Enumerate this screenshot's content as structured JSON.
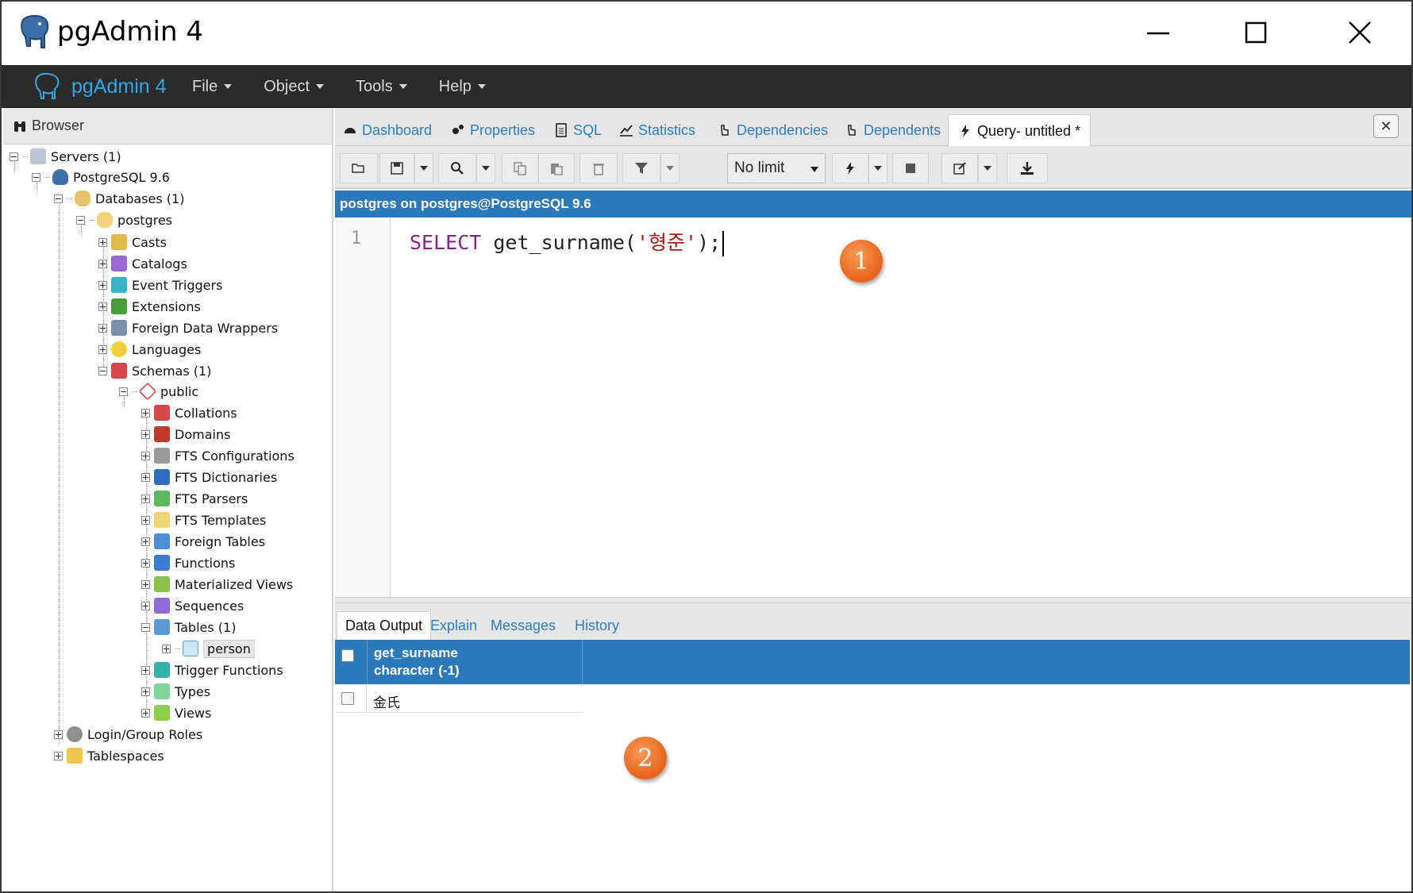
{
  "window": {
    "title": "pgAdmin 4"
  },
  "navbar": {
    "brand": "pgAdmin 4",
    "menus": [
      "File",
      "Object",
      "Tools",
      "Help"
    ]
  },
  "browser": {
    "title": "Browser",
    "tree": [
      "Servers (1)",
      "PostgreSQL 9.6",
      "Databases (1)",
      "postgres",
      "Casts",
      "Catalogs",
      "Event Triggers",
      "Extensions",
      "Foreign Data Wrappers",
      "Languages",
      "Schemas (1)",
      "public",
      "Collations",
      "Domains",
      "FTS Configurations",
      "FTS Dictionaries",
      "FTS Parsers",
      "FTS Templates",
      "Foreign Tables",
      "Functions",
      "Materialized Views",
      "Sequences",
      "Tables (1)",
      "person",
      "Trigger Functions",
      "Types",
      "Views",
      "Login/Group Roles",
      "Tablespaces"
    ]
  },
  "tabs": [
    "Dashboard",
    "Properties",
    "SQL",
    "Statistics",
    "Dependencies",
    "Dependents",
    "Query- untitled *"
  ],
  "toolbar": {
    "limit": "No limit"
  },
  "connection": "postgres on postgres@PostgreSQL 9.6",
  "editor": {
    "line_number": "1",
    "keyword": "SELECT",
    "func": " get_surname(",
    "string": "'형준'",
    "tail": ");"
  },
  "markers": [
    "1",
    "2"
  ],
  "output_tabs": [
    "Data Output",
    "Explain",
    "Messages",
    "History"
  ],
  "grid": {
    "column_name": "get_surname",
    "column_type": "character (-1)",
    "rows": [
      "金氏"
    ]
  },
  "colors": {
    "navbar": "#2b2b2b",
    "accent": "#2b79ba",
    "brand": "#2ea8e6",
    "marker": "#e9631a"
  }
}
